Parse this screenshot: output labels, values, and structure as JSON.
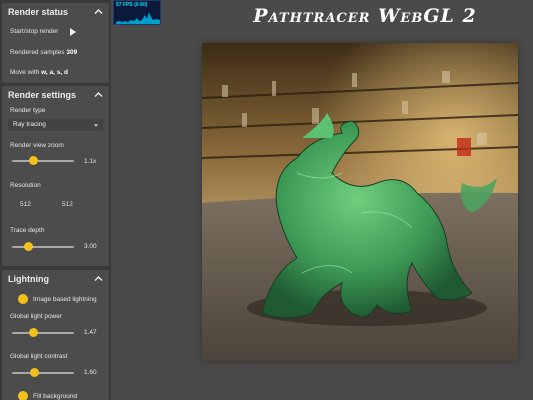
{
  "fps_meter": {
    "label": "57 FPS (0-60)"
  },
  "app_title": "Pathtracer WebGL 2",
  "render_status": {
    "title": "Render status",
    "start_stop_label": "Start/stop render",
    "samples_label": "Rendered samples",
    "samples_value": "309",
    "move_label": "Move with",
    "move_keys": "w, a, s, d"
  },
  "render_settings": {
    "title": "Render settings",
    "render_type_label": "Render type",
    "render_type_value": "Ray tracing",
    "zoom_label": "Render view zoom",
    "zoom_value": "1.1x",
    "zoom_level": 0.35,
    "resolution_label": "Resolution",
    "resolution_w": "512",
    "resolution_h": "512",
    "trace_depth_label": "Trace depth",
    "trace_depth_value": "3.00",
    "trace_depth_level": 0.27
  },
  "lightning": {
    "title": "Lightning",
    "ibl_label": "Image based lightning",
    "global_power_label": "Global light power",
    "global_power_value": "1.47",
    "global_power_level": 0.35,
    "global_contrast_label": "Global light contrast",
    "global_contrast_value": "1.60",
    "global_contrast_level": 0.37,
    "fill_background_label": "Fill background"
  },
  "colors": {
    "accent": "#f2c21b",
    "panel": "#4c4c4c",
    "sidebar": "#3a3a3a",
    "background": "#4a4a4a"
  }
}
